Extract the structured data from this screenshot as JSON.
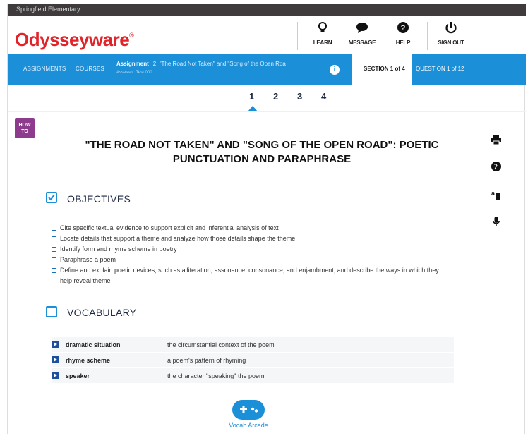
{
  "school": "Springfield Elementary",
  "logo": {
    "text": "Odysseyware",
    "mark": "®"
  },
  "header_buttons": [
    {
      "label": "LEARN",
      "icon": "lightbulb-icon"
    },
    {
      "label": "MESSAGE",
      "icon": "chat-bubble-icon"
    },
    {
      "label": "HELP",
      "icon": "question-circle-icon"
    },
    {
      "label": "SIGN OUT",
      "icon": "power-icon"
    }
  ],
  "nav": {
    "assignments": "ASSIGNMENTS",
    "courses": "COURSES",
    "assignment_label": "Assignment",
    "assignment_title": "2. \"The Road Not Taken\" and \"Song of the Open Roa",
    "assignment_sub": "Assessor: Test 000",
    "section": "SECTION 1 of 4",
    "question": "QUESTION 1 of 12"
  },
  "pager": [
    "1",
    "2",
    "3",
    "4"
  ],
  "how_to": "HOW TO",
  "title_line1": "\"THE ROAD NOT TAKEN\" AND \"SONG OF THE OPEN ROAD\": POETIC",
  "title_line2": "PUNCTUATION AND PARAPHRASE",
  "objectives": {
    "heading": "OBJECTIVES",
    "items": [
      "Cite specific textual evidence to support explicit and inferential analysis of text",
      "Locate details that support a theme and analyze how those details shape the theme",
      "Identify form and rhyme scheme in poetry",
      "Paraphrase a poem",
      "Define and explain poetic devices, such as alliteration, assonance, consonance, and enjambment, and describe the ways in which they help reveal theme"
    ]
  },
  "vocabulary": {
    "heading": "VOCABULARY",
    "items": [
      {
        "term": "dramatic situation",
        "def": "the circumstantial context of the poem"
      },
      {
        "term": "rhyme scheme",
        "def": "a poem's pattern of rhyming"
      },
      {
        "term": "speaker",
        "def": "the character \"speaking\" the poem"
      }
    ]
  },
  "arcade_label": "Vocab Arcade",
  "colors": {
    "brand_red": "#e2232a",
    "nav_blue": "#1b8fd7",
    "howto_purple": "#8e3b8e"
  }
}
